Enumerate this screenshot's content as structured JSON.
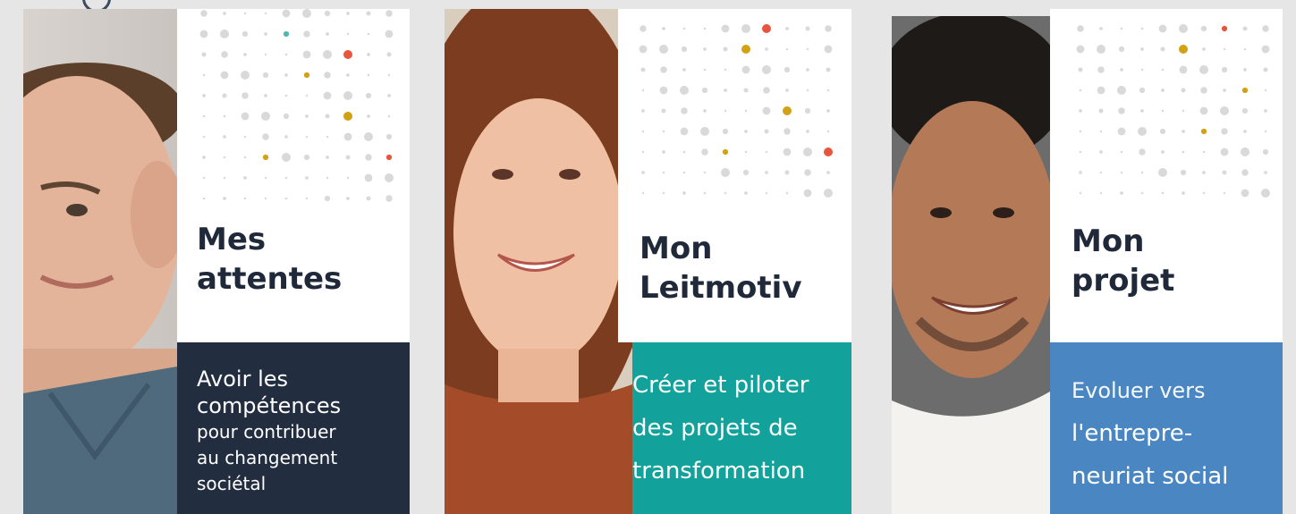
{
  "cards": [
    {
      "title_line1": "Mes",
      "title_line2": "attentes",
      "desc_lines": [
        "Avoir les",
        "compétences",
        "pour contribuer",
        "au changement",
        "sociétal"
      ],
      "panel_color": "#232d40",
      "photo_alt": "portrait-man-smiling"
    },
    {
      "title_line1": "Mon",
      "title_line2": "Leitmotiv",
      "desc_lines": [
        "Créer et piloter",
        "des projets de",
        "transformation"
      ],
      "panel_color": "#12a29b",
      "photo_alt": "portrait-woman-smiling"
    },
    {
      "title_line1": "Mon",
      "title_line2": "projet",
      "desc_lines": [
        "Evoluer vers",
        "l'entrepre-",
        "neuriat social"
      ],
      "panel_color": "#4a86c2",
      "photo_alt": "portrait-man-laughing"
    }
  ],
  "accent_colors": {
    "red": "#e8553e",
    "gold": "#d1a214",
    "teal": "#4fb8ac",
    "grey_dot": "#d9d9d9"
  }
}
